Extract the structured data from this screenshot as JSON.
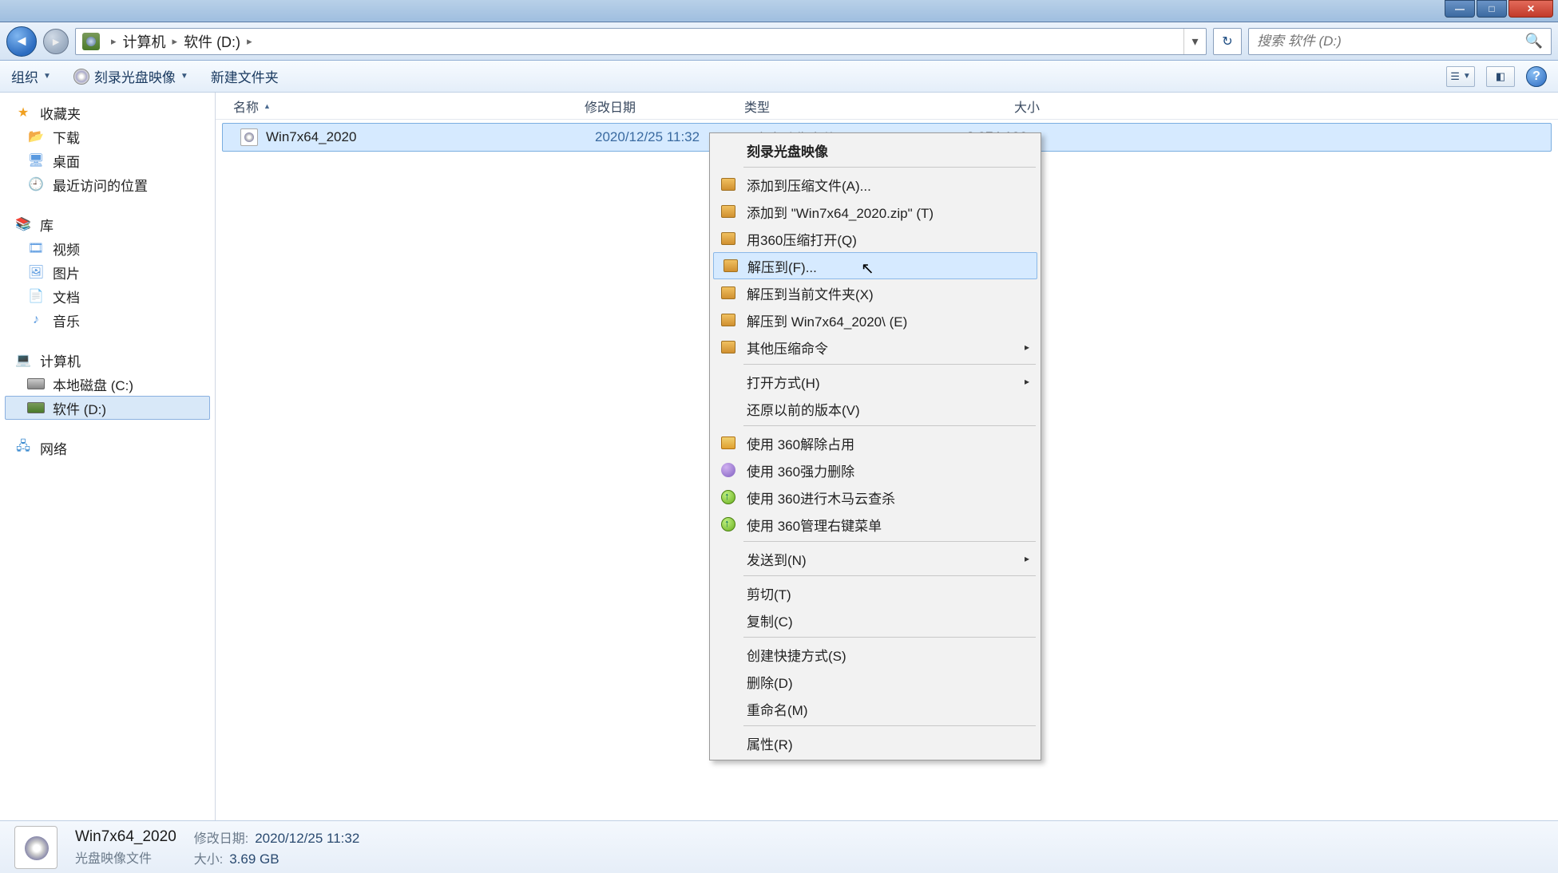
{
  "breadcrumb": {
    "root": "计算机",
    "folder": "软件 (D:)"
  },
  "search": {
    "placeholder": "搜索 软件 (D:)"
  },
  "toolbar": {
    "organize": "组织",
    "burn": "刻录光盘映像",
    "newfolder": "新建文件夹"
  },
  "columns": {
    "name": "名称",
    "date": "修改日期",
    "type": "类型",
    "size": "大小"
  },
  "sidebar": {
    "fav_head": "收藏夹",
    "fav": [
      "下载",
      "桌面",
      "最近访问的位置"
    ],
    "lib_head": "库",
    "lib": [
      "视频",
      "图片",
      "文档",
      "音乐"
    ],
    "comp_head": "计算机",
    "drives": [
      "本地磁盘 (C:)",
      "软件 (D:)"
    ],
    "net_head": "网络"
  },
  "file": {
    "name": "Win7x64_2020",
    "date": "2020/12/25 11:32",
    "type": "光盘映像文件",
    "size": "3,874,126 ..."
  },
  "context": {
    "burn": "刻录光盘映像",
    "add_archive": "添加到压缩文件(A)...",
    "add_zip": "添加到 \"Win7x64_2020.zip\" (T)",
    "open_360zip": "用360压缩打开(Q)",
    "extract_to": "解压到(F)...",
    "extract_here": "解压到当前文件夹(X)",
    "extract_named": "解压到 Win7x64_2020\\ (E)",
    "other_zip": "其他压缩命令",
    "open_with": "打开方式(H)",
    "restore_prev": "还原以前的版本(V)",
    "u360_unlock": "使用 360解除占用",
    "u360_delete": "使用 360强力删除",
    "u360_scan": "使用 360进行木马云查杀",
    "u360_menu": "使用 360管理右键菜单",
    "send_to": "发送到(N)",
    "cut": "剪切(T)",
    "copy": "复制(C)",
    "shortcut": "创建快捷方式(S)",
    "delete": "删除(D)",
    "rename": "重命名(M)",
    "props": "属性(R)"
  },
  "details": {
    "name": "Win7x64_2020",
    "type": "光盘映像文件",
    "date_k": "修改日期:",
    "date_v": "2020/12/25 11:32",
    "size_k": "大小:",
    "size_v": "3.69 GB"
  }
}
